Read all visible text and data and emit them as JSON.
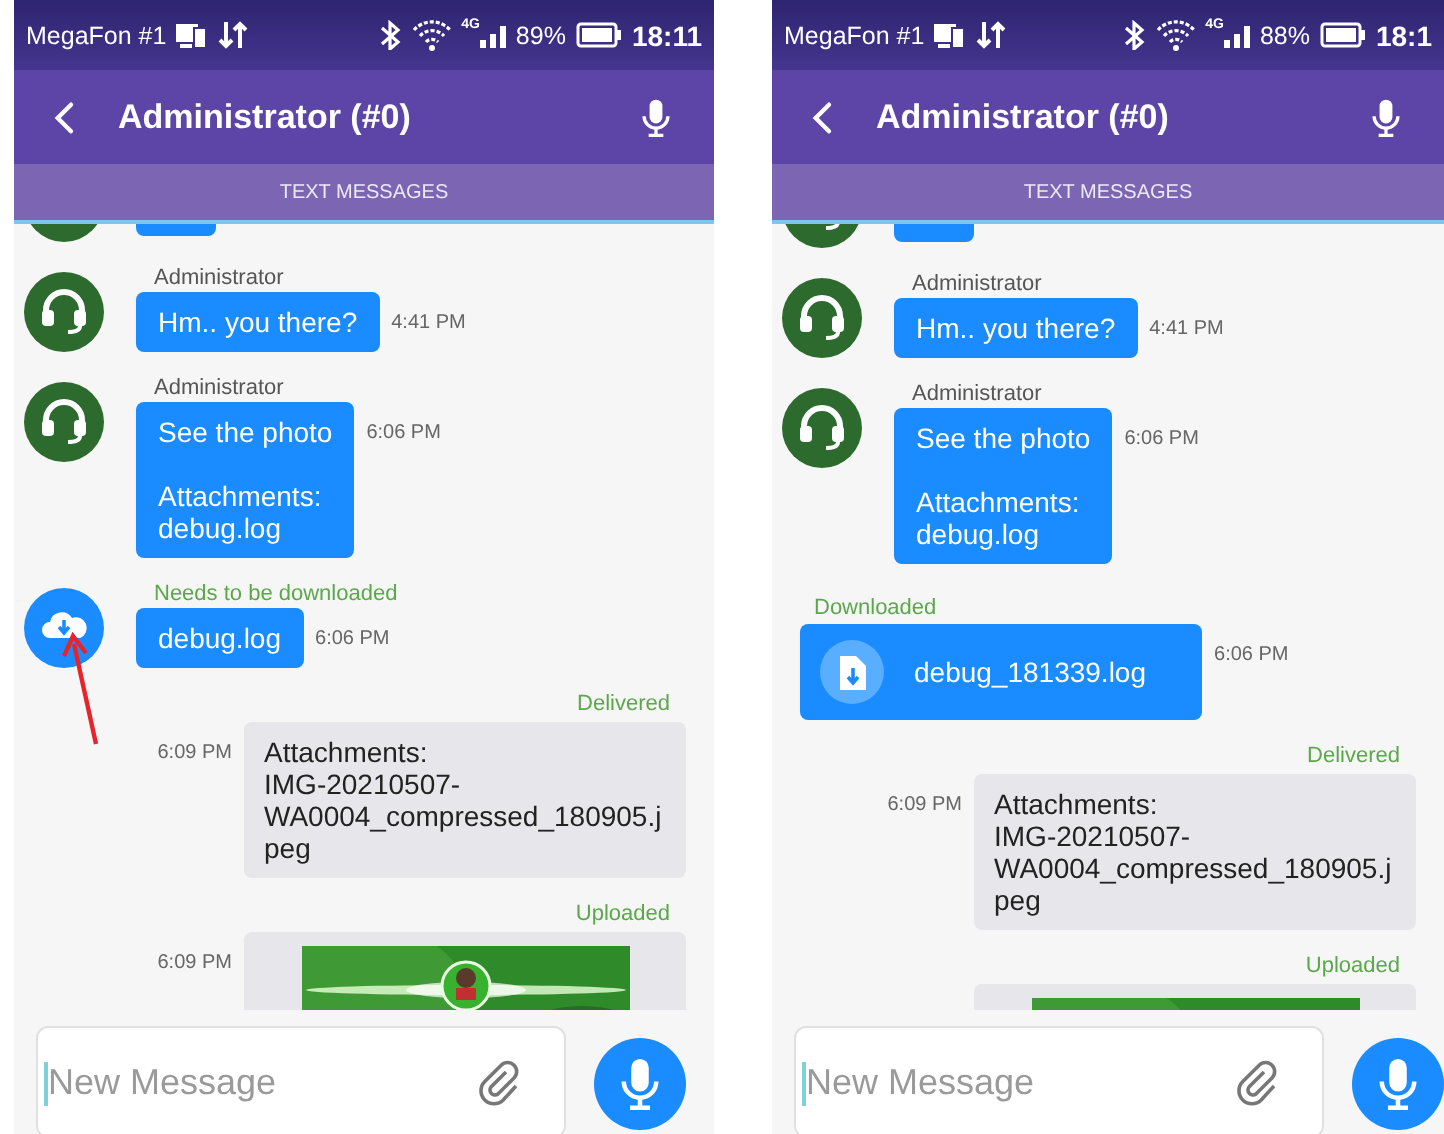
{
  "phones": [
    {
      "status_bar": {
        "carrier": "MegaFon #1",
        "network": "4G",
        "battery": "89%",
        "time": "18:11"
      },
      "header": {
        "title": "Administrator (#0)"
      },
      "tab": {
        "label": "TEXT MESSAGES"
      },
      "messages": [
        {
          "kind": "clipped"
        },
        {
          "kind": "incoming",
          "sender": "Administrator",
          "text": "Hm.. you there?",
          "time": "4:41 PM"
        },
        {
          "kind": "incoming",
          "sender": "Administrator",
          "text": "See the photo\n\nAttachments:\ndebug.log",
          "time": "6:06 PM"
        },
        {
          "kind": "file",
          "status": "Needs to be downloaded",
          "name": "debug.log",
          "time": "6:06 PM",
          "downloaded": false
        },
        {
          "kind": "outgoing",
          "status": "Delivered",
          "time": "6:09 PM",
          "text": "Attachments:\nIMG-20210507-WA0004_compressed_180905.jpeg"
        },
        {
          "kind": "outgoing_image",
          "status": "Uploaded",
          "time": "6:09 PM"
        }
      ],
      "annotation": {
        "kind": "arrow"
      },
      "composer": {
        "placeholder": "New Message"
      }
    },
    {
      "status_bar": {
        "carrier": "MegaFon #1",
        "network": "4G",
        "battery": "88%",
        "time": "18:1"
      },
      "header": {
        "title": "Administrator (#0)"
      },
      "tab": {
        "label": "TEXT MESSAGES"
      },
      "messages": [
        {
          "kind": "clipped"
        },
        {
          "kind": "incoming",
          "sender": "Administrator",
          "text": "Hm.. you there?",
          "time": "4:41 PM"
        },
        {
          "kind": "incoming",
          "sender": "Administrator",
          "text": "See the photo\n\nAttachments:\ndebug.log",
          "time": "6:06 PM"
        },
        {
          "kind": "file",
          "status": "Downloaded",
          "name": "debug_181339.log",
          "time": "6:06 PM",
          "downloaded": true
        },
        {
          "kind": "outgoing",
          "status": "Delivered",
          "time": "6:09 PM",
          "text": "Attachments:\nIMG-20210507-WA0004_compressed_180905.jpeg"
        },
        {
          "kind": "outgoing_image",
          "status": "Uploaded"
        }
      ],
      "composer": {
        "placeholder": "New Message"
      }
    }
  ]
}
